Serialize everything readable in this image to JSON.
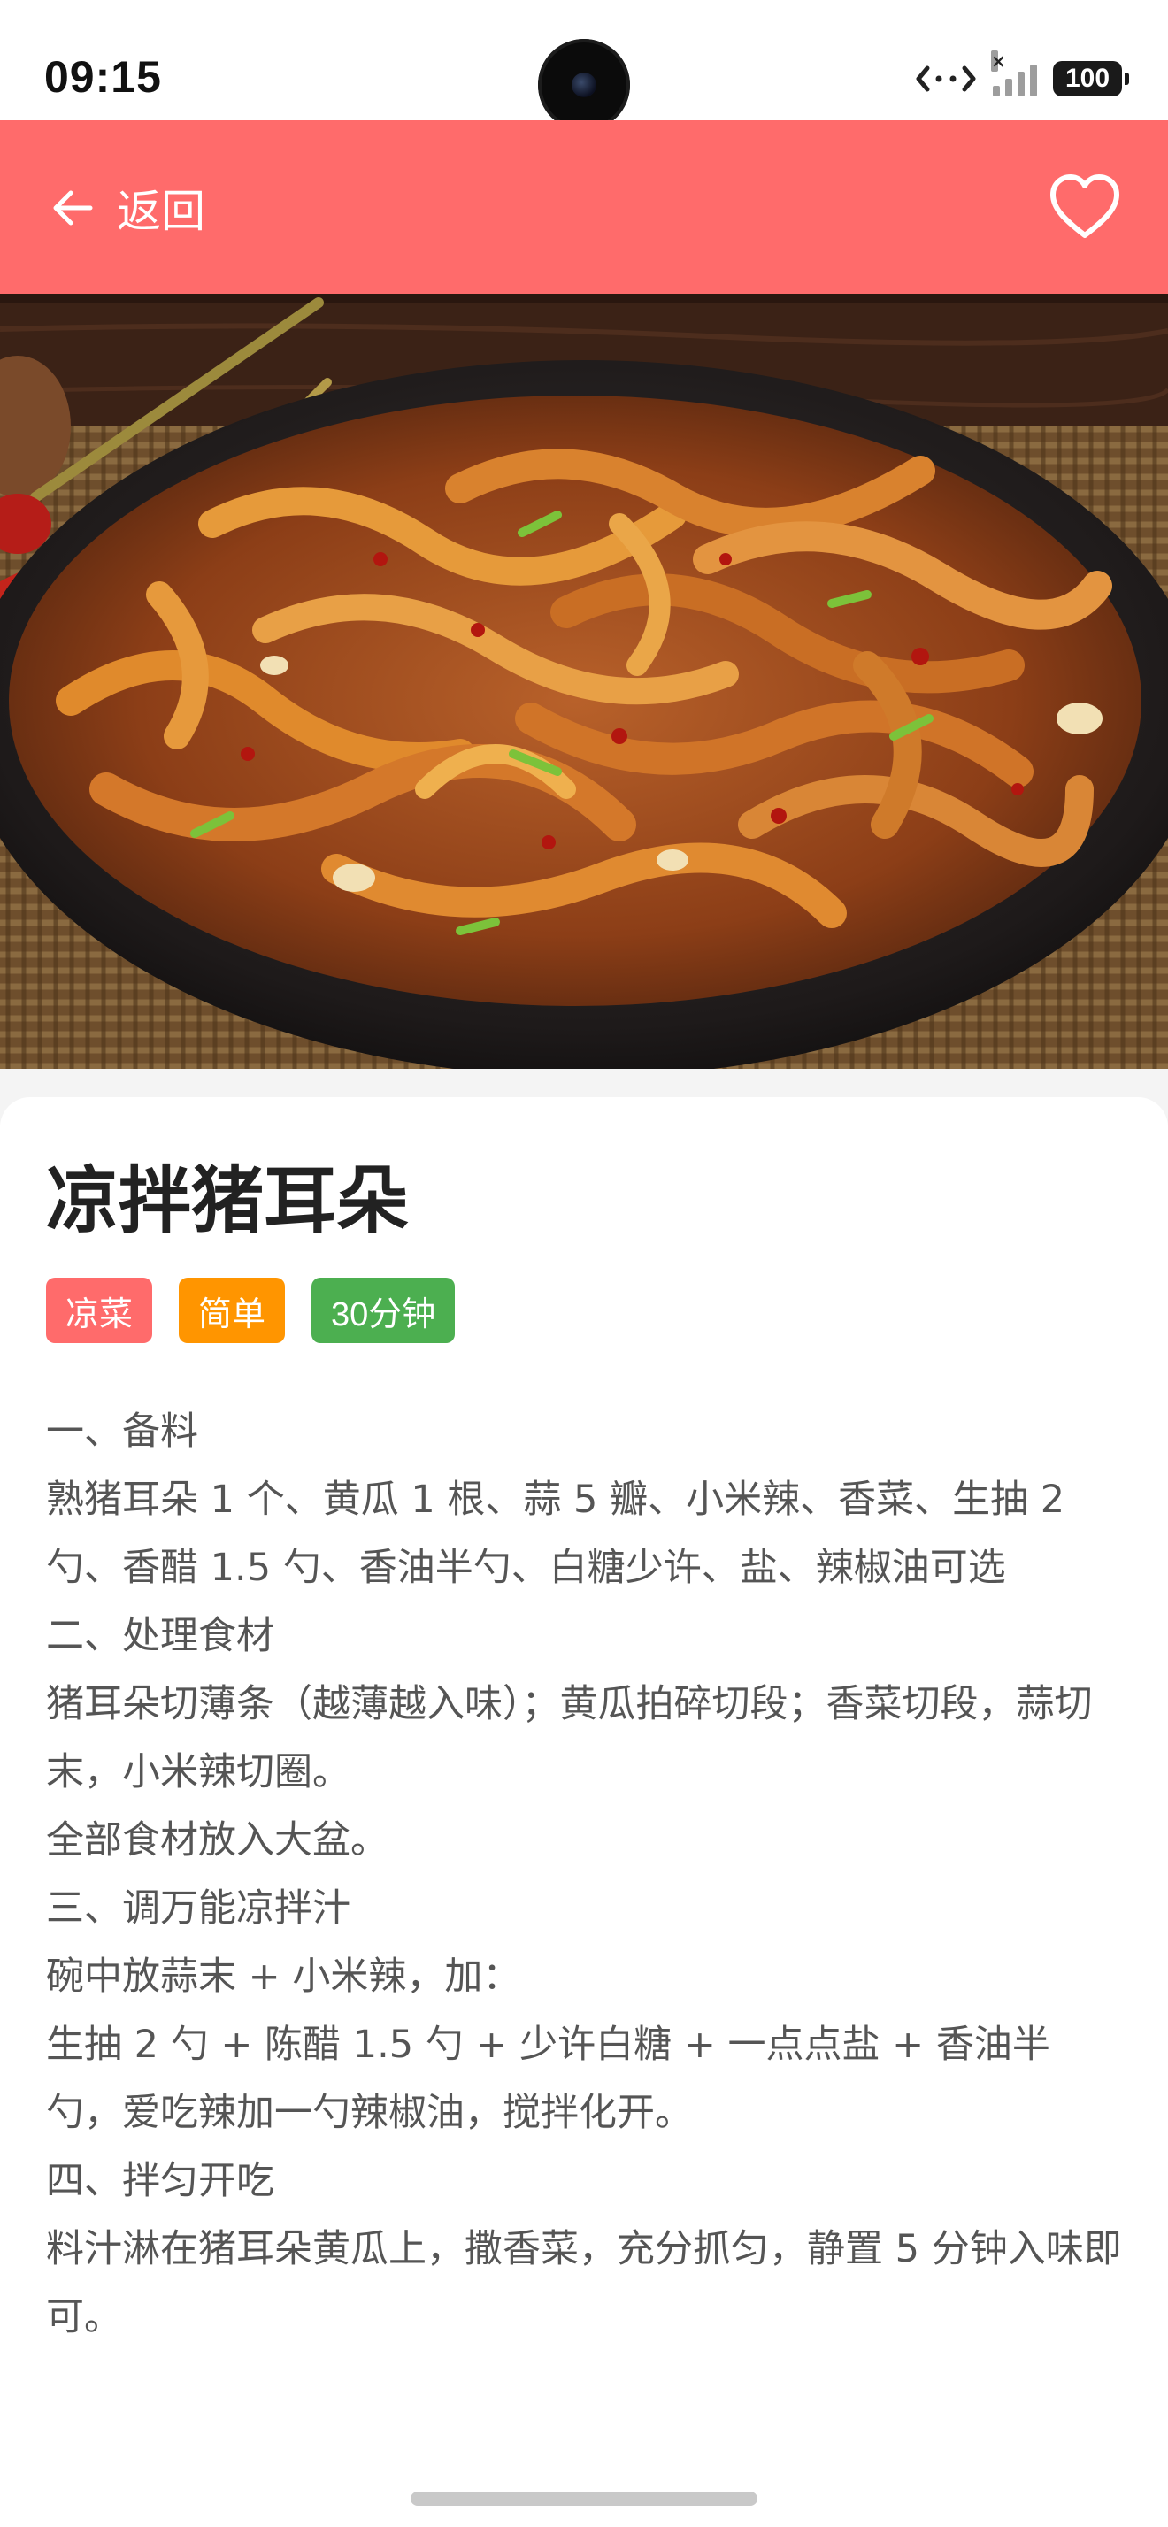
{
  "status_bar": {
    "time": "09:15",
    "battery": "100"
  },
  "header": {
    "back_label": "返回",
    "back_icon": "arrow-left-icon",
    "favorite_icon": "heart-outline-icon"
  },
  "recipe": {
    "title": "凉拌猪耳朵",
    "tags": [
      "凉菜",
      "简单",
      "30分钟"
    ],
    "paragraphs": [
      "一、备料",
      "熟猪耳朵 1 个、黄瓜 1 根、蒜 5 瓣、小米辣、香菜、生抽 2 勺、香醋 1.5 勺、香油半勺、白糖少许、盐、辣椒油可选",
      "二、处理食材",
      "猪耳朵切薄条（越薄越入味）；黄瓜拍碎切段；香菜切段，蒜切末，小米辣切圈。",
      "全部食材放入大盆。",
      "三、调万能凉拌汁",
      "碗中放蒜末 + 小米辣，加：",
      "生抽 2 勺 + 陈醋 1.5 勺 + 少许白糖 + 一点点盐 + 香油半勺，爱吃辣加一勺辣椒油，搅拌化开。",
      "四、拌匀开吃",
      "料汁淋在猪耳朵黄瓜上，撒香菜，充分抓匀，静置 5 分钟入味即可。"
    ]
  },
  "colors": {
    "header_bg": "#ff6b6b",
    "tag_colors": [
      "#ff6b6b",
      "#ff9500",
      "#4caf50"
    ]
  }
}
